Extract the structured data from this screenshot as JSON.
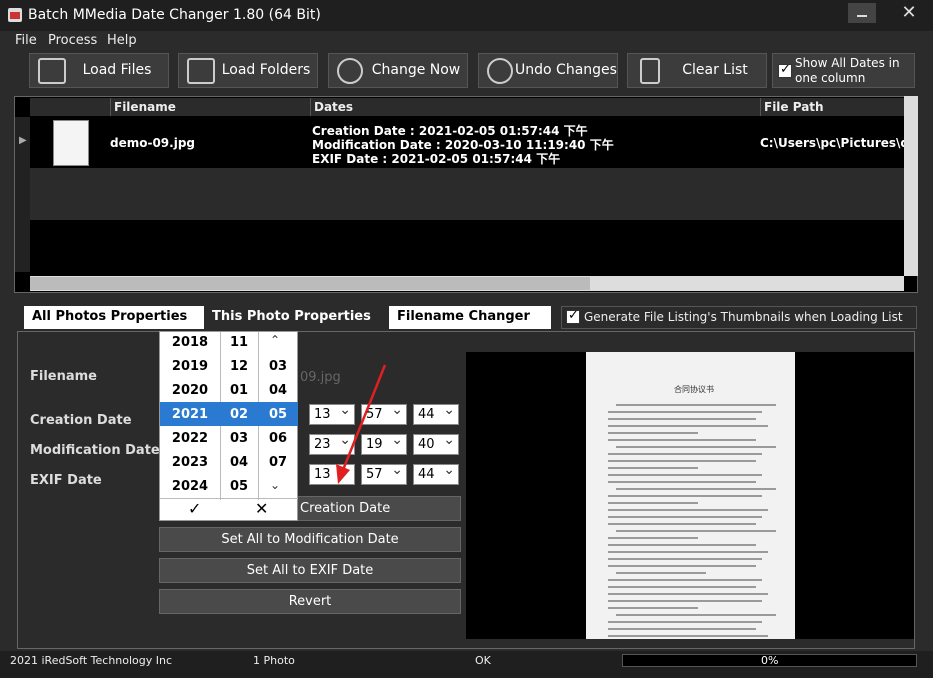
{
  "window": {
    "title": "Batch MMedia Date Changer 1.80 (64 Bit)"
  },
  "menu": [
    "File",
    "Process",
    "Help"
  ],
  "toolbar": {
    "load_files": "Load Files",
    "load_folders": "Load Folders",
    "change_now": "Change Now",
    "undo_changes": "Undo Changes",
    "clear_list": "Clear List",
    "show_all_dates": "Show All Dates in one column",
    "show_all_dates_checked": true
  },
  "grid": {
    "columns": [
      "Filename",
      "Dates",
      "File Path"
    ],
    "rows": [
      {
        "filename": "demo-09.jpg",
        "creation": "Creation Date : 2021-02-05 01:57:44 下午",
        "modification": "Modification Date : 2020-03-10 11:19:40 下午",
        "exif": "EXIF Date : 2021-02-05 01:57:44 下午",
        "path": "C:\\Users\\pc\\Pictures\\d"
      }
    ]
  },
  "tabs": [
    "All Photos Properties",
    "This Photo Properties",
    "Filename Changer"
  ],
  "generate_thumbs": {
    "label": "Generate File Listing's Thumbnails when Loading List",
    "checked": true
  },
  "panel": {
    "filename_label": "Filename",
    "filename_value": "09.jpg",
    "creation_label": "Creation Date",
    "modification_label": "Modification Date",
    "exif_label": "EXIF Date",
    "creation_time": [
      "13",
      "57",
      "44"
    ],
    "modification_time": [
      "23",
      "19",
      "40"
    ],
    "exif_time": [
      "13",
      "57",
      "44"
    ],
    "set_creation": "Creation Date",
    "set_modification": "Set All to Modification Date",
    "set_exif": "Set All to EXIF Date",
    "revert": "Revert"
  },
  "picker": {
    "years": [
      "2018",
      "2019",
      "2020",
      "2021",
      "2022",
      "2023",
      "2024"
    ],
    "months": [
      "11",
      "12",
      "01",
      "02",
      "03",
      "04",
      "05"
    ],
    "days": [
      "03",
      "04",
      "05",
      "06",
      "07"
    ],
    "ok_glyph": "✓",
    "cancel_glyph": "✕"
  },
  "document": {
    "title": "合同协议书"
  },
  "status": {
    "company": "2021 iRedSoft Technology Inc",
    "count": "1 Photo",
    "state": "OK",
    "progress": "0%",
    "progress_value": 0
  },
  "colors": {
    "selection": "#2a7ad2",
    "arrow": "#e02020"
  }
}
